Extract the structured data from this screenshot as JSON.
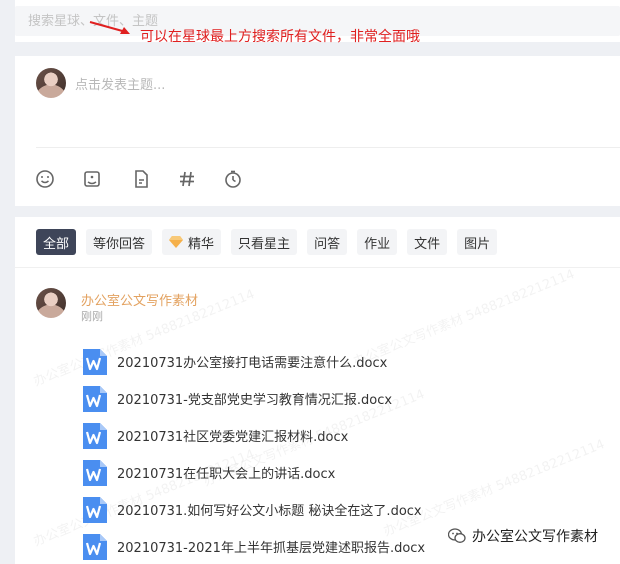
{
  "search": {
    "placeholder": "搜索星球、文件、主题"
  },
  "annotation": {
    "text": "可以在星球最上方搜索所有文件，非常全面哦"
  },
  "composer": {
    "placeholder": "点击发表主题...",
    "tools": [
      "emoji-icon",
      "image-icon",
      "file-icon",
      "hashtag-icon",
      "timer-icon"
    ]
  },
  "filters": [
    {
      "label": "全部",
      "active": true
    },
    {
      "label": "等你回答",
      "active": false
    },
    {
      "label": "精华",
      "active": false,
      "icon": "gem-icon"
    },
    {
      "label": "只看星主",
      "active": false
    },
    {
      "label": "问答",
      "active": false
    },
    {
      "label": "作业",
      "active": false
    },
    {
      "label": "文件",
      "active": false
    },
    {
      "label": "图片",
      "active": false
    }
  ],
  "post": {
    "author": "办公室公文写作素材",
    "time": "刚刚",
    "files": [
      "20210731办公室接打电话需要注意什么.docx",
      "20210731-党支部党史学习教育情况汇报.docx",
      "20210731社区党委党建汇报材料.docx",
      "20210731在任职大会上的讲话.docx",
      "20210731.如何写好公文小标题 秘诀全在这了.docx",
      "20210731-2021年上半年抓基层党建述职报告.docx"
    ]
  },
  "watermark": "办公室公文写作素材 54882182212114",
  "footer": {
    "brand": "办公室公文写作素材"
  },
  "colors": {
    "accent": "#3e4559",
    "author": "#e3a260",
    "annotation": "#e02020",
    "file_icon": "#4a8ef0"
  }
}
